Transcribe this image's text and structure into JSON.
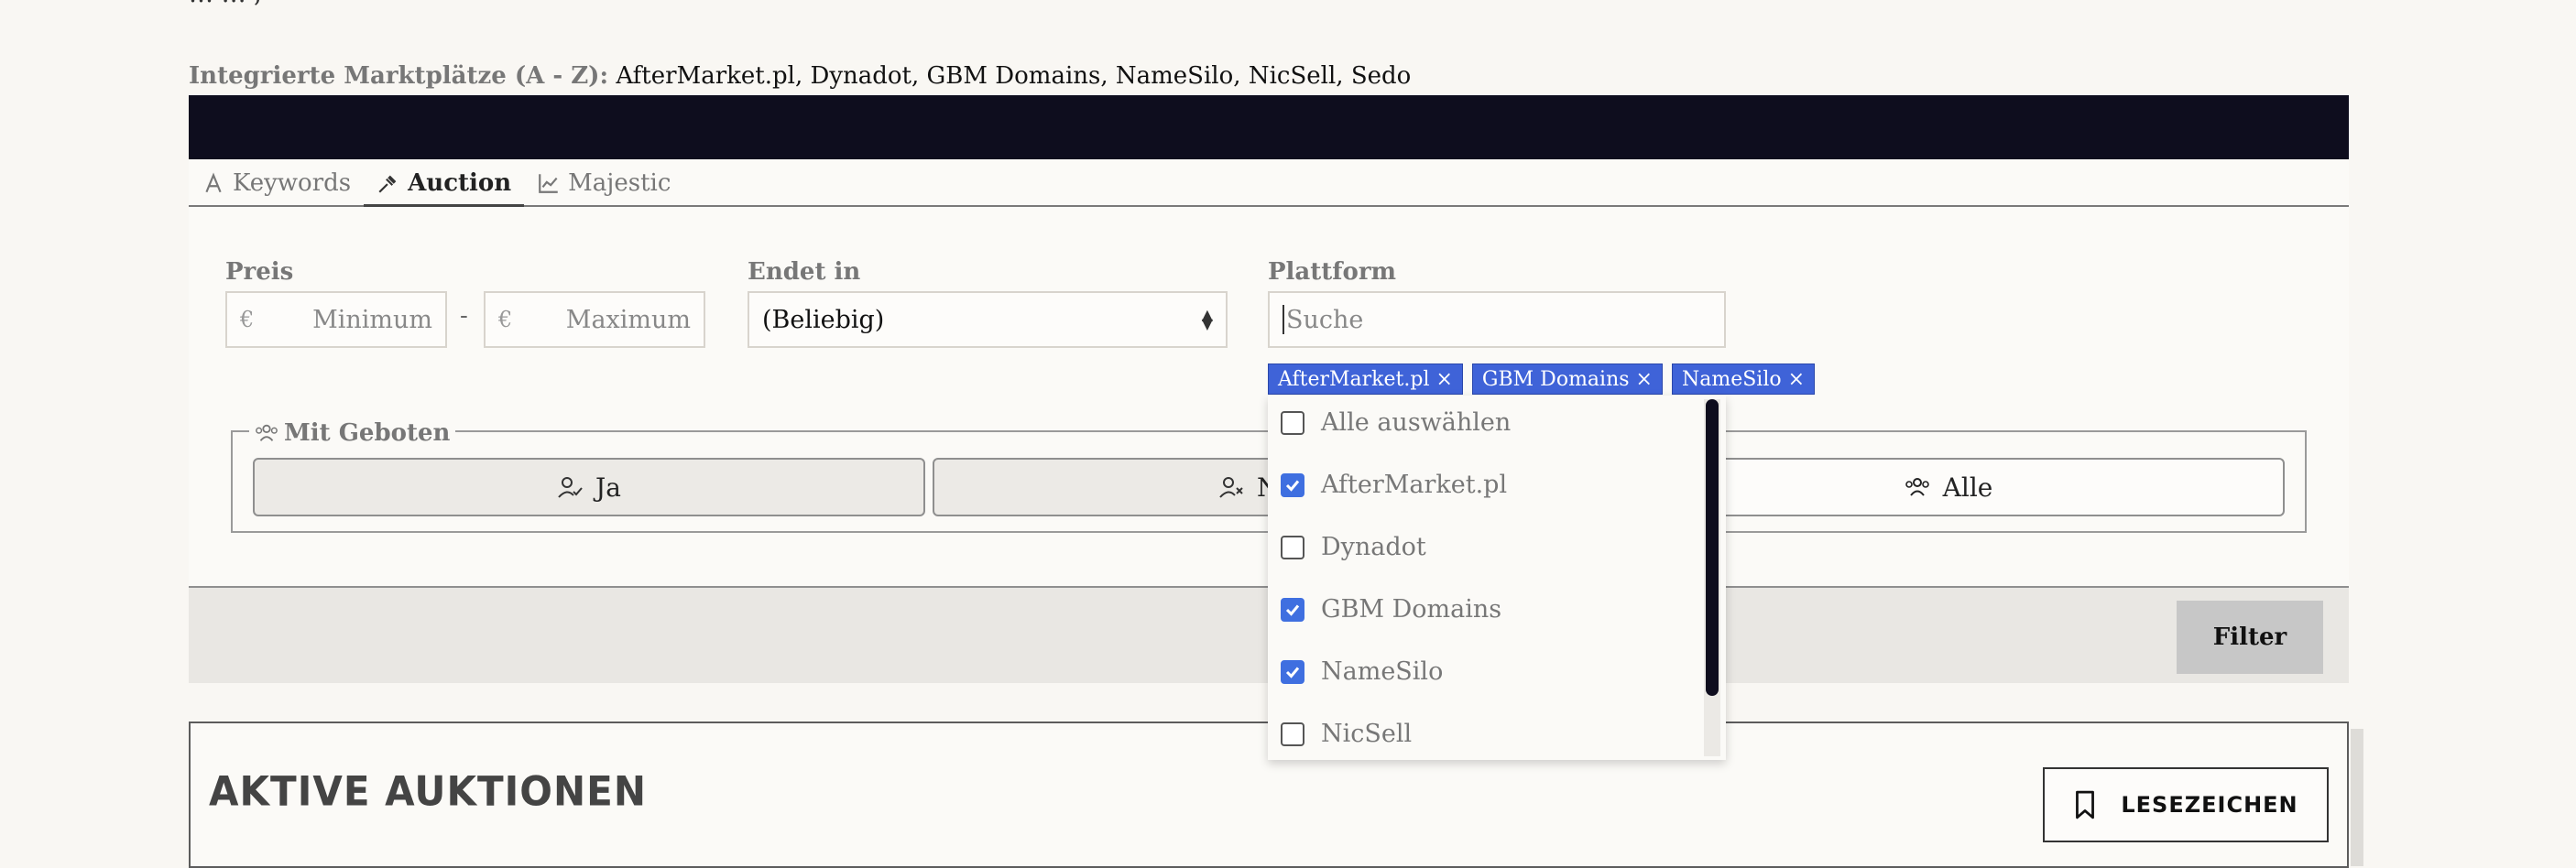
{
  "header": {
    "cut_text": "… … ,",
    "markets_label": "Integrierte Marktplätze (A - Z):",
    "markets": [
      "AfterMarket.pl",
      "Dynadot",
      "GBM Domains",
      "NameSilo",
      "NicSell",
      "Sedo"
    ]
  },
  "tabs": [
    {
      "label": "Keywords",
      "icon": "letter-a-icon",
      "active": false
    },
    {
      "label": "Auction",
      "icon": "gavel-icon",
      "active": true
    },
    {
      "label": "Majestic",
      "icon": "chart-line-icon",
      "active": false
    }
  ],
  "filters": {
    "price": {
      "label": "Preis",
      "currency": "€",
      "min_placeholder": "Minimum",
      "max_placeholder": "Maximum",
      "separator": "-"
    },
    "ends_in": {
      "label": "Endet in",
      "value": "(Beliebig)"
    },
    "platform": {
      "label": "Plattform",
      "placeholder": "Suche",
      "selected_chips": [
        "AfterMarket.pl ×",
        "GBM Domains ×",
        "NameSilo ×"
      ]
    }
  },
  "bids": {
    "legend": "Mit Geboten",
    "options": [
      {
        "label": "Ja",
        "icon": "user-check-icon"
      },
      {
        "label": "Nein",
        "icon": "user-x-icon"
      },
      {
        "label": "Alle",
        "icon": "users-icon"
      }
    ],
    "selected": "Alle"
  },
  "dropdown": {
    "options": [
      {
        "label": "Alle auswählen",
        "checked": false
      },
      {
        "label": "AfterMarket.pl",
        "checked": true
      },
      {
        "label": "Dynadot",
        "checked": false
      },
      {
        "label": "GBM Domains",
        "checked": true
      },
      {
        "label": "NameSilo",
        "checked": true
      },
      {
        "label": "NicSell",
        "checked": false
      }
    ]
  },
  "footer": {
    "filter_label": "Filter"
  },
  "section": {
    "title": "Aktive Auktionen",
    "bookmark_label": "Lesezeichen"
  },
  "colors": {
    "topbar": "#0e0d1e",
    "chip": "#3f63d8",
    "checkbox": "#3f6fe0"
  }
}
